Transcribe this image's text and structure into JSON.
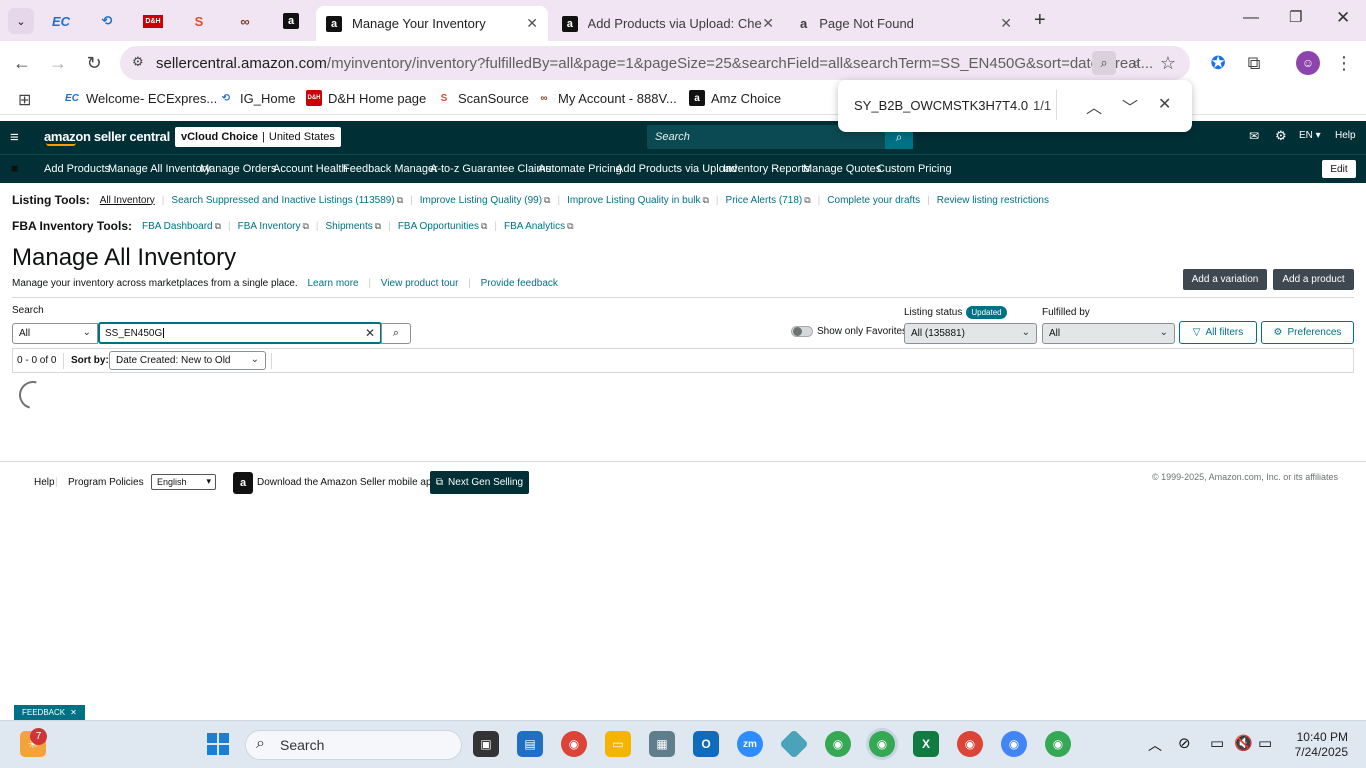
{
  "browser": {
    "tabs": [
      {
        "title": "Manage Your Inventory",
        "active": true
      },
      {
        "title": "Add Products via Upload: Chec",
        "active": false
      },
      {
        "title": "Page Not Found",
        "active": false
      }
    ],
    "pinned_icons": [
      "EC",
      "D&H",
      "S"
    ],
    "url_host": "sellercentral.amazon.com",
    "url_path": "/myinventory/inventory?fulfilledBy=all&page=1&pageSize=25&searchField=all&searchTerm=SS_EN450G&sort=date_creat...",
    "bookmarks": [
      {
        "label": "Welcome- ECExpres...",
        "icon": "EC"
      },
      {
        "label": "IG_Home",
        "icon": "IG"
      },
      {
        "label": "D&H Home page",
        "icon": "D&H"
      },
      {
        "label": "ScanSource",
        "icon": "S"
      },
      {
        "label": "My Account - 888V...",
        "icon": "∞"
      },
      {
        "label": "Amz Choice",
        "icon": "a"
      }
    ],
    "find": {
      "query": "SY_B2B_OWCMSTK3H7T4.0",
      "count": "1/1"
    }
  },
  "header": {
    "logo": "amazon seller central",
    "account_name": "vCloud Choice",
    "marketplace": "United States",
    "search_placeholder": "Search",
    "language": "EN",
    "help": "Help"
  },
  "nav": {
    "items": [
      "Add Products",
      "Manage All Inventory",
      "Manage Orders",
      "Account Health",
      "Feedback Manager",
      "A-to-z Guarantee Claims",
      "Automate Pricing",
      "Add Products via Upload",
      "Inventory Reports",
      "Manage Quotes",
      "Custom Pricing"
    ],
    "edit": "Edit"
  },
  "listing_tools": {
    "label": "Listing Tools:",
    "items": [
      "All Inventory",
      "Search Suppressed and Inactive Listings (113589)",
      "Improve Listing Quality (99)",
      "Improve Listing Quality in bulk",
      "Price Alerts (718)",
      "Complete your drafts",
      "Review listing restrictions"
    ]
  },
  "fba_tools": {
    "label": "FBA Inventory Tools:",
    "items": [
      "FBA Dashboard",
      "FBA Inventory",
      "Shipments",
      "FBA Opportunities",
      "FBA Analytics"
    ]
  },
  "page": {
    "title": "Manage All Inventory",
    "subtitle": "Manage your inventory across marketplaces from a single place.",
    "links": [
      "Learn more",
      "View product tour",
      "Provide feedback"
    ],
    "add_variation": "Add a variation",
    "add_product": "Add a product"
  },
  "filters": {
    "search_label": "Search",
    "search_field": "All",
    "search_value": "SS_EN450G",
    "favorites_label": "Show only Favorites",
    "listing_status_label": "Listing status",
    "updated_badge": "Updated",
    "listing_status_value": "All (135881)",
    "fulfilled_by_label": "Fulfilled by",
    "fulfilled_by_value": "All",
    "all_filters": "All filters",
    "preferences": "Preferences"
  },
  "results": {
    "count": "0 - 0 of 0",
    "sort_label": "Sort by:",
    "sort_value": "Date Created: New to Old"
  },
  "footer": {
    "help": "Help",
    "policies": "Program Policies",
    "language": "English",
    "app": "Download the Amazon Seller mobile app",
    "next_gen": "Next Gen Selling",
    "copyright": "© 1999-2025, Amazon.com, Inc. or its affiliates"
  },
  "feedback_tab": "FEEDBACK",
  "taskbar": {
    "search": "Search",
    "badge": "7",
    "time": "10:40 PM",
    "date": "7/24/2025"
  },
  "colors": {
    "header_bg": "#002f36",
    "link": "#007185",
    "tab_bg": "#f1e5f4"
  }
}
